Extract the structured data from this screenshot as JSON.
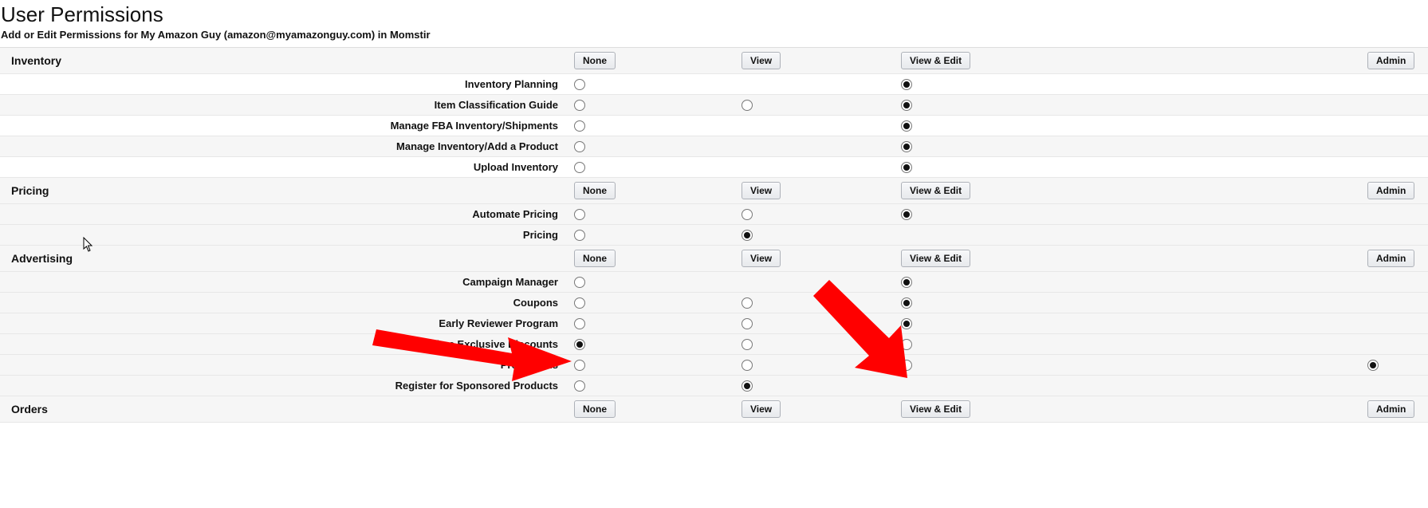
{
  "page_title": "User Permissions",
  "subtitle": "Add or Edit Permissions for My Amazon Guy (amazon@myamazonguy.com) in Momstir",
  "col_buttons": {
    "none": "None",
    "view": "View",
    "view_edit": "View & Edit",
    "admin": "Admin"
  },
  "sections": [
    {
      "name": "Inventory",
      "rows": [
        {
          "label": "Inventory Planning",
          "cells": {
            "none": "empty",
            "view": null,
            "ve": "checked",
            "admin": null
          }
        },
        {
          "label": "Item Classification Guide",
          "cells": {
            "none": "empty",
            "view": "empty",
            "ve": "checked",
            "admin": null
          }
        },
        {
          "label": "Manage FBA Inventory/Shipments",
          "cells": {
            "none": "empty",
            "view": null,
            "ve": "checked",
            "admin": null
          }
        },
        {
          "label": "Manage Inventory/Add a Product",
          "cells": {
            "none": "empty",
            "view": null,
            "ve": "checked",
            "admin": null
          }
        },
        {
          "label": "Upload Inventory",
          "cells": {
            "none": "empty",
            "view": null,
            "ve": "checked",
            "admin": null
          }
        }
      ]
    },
    {
      "name": "Pricing",
      "rows": [
        {
          "label": "Automate Pricing",
          "cells": {
            "none": "empty",
            "view": "empty",
            "ve": "checked",
            "admin": null
          }
        },
        {
          "label": "Pricing",
          "cells": {
            "none": "empty",
            "view": "checked",
            "ve": null,
            "admin": null
          }
        }
      ]
    },
    {
      "name": "Advertising",
      "rows": [
        {
          "label": "Campaign Manager",
          "cells": {
            "none": "empty",
            "view": null,
            "ve": "checked",
            "admin": null
          }
        },
        {
          "label": "Coupons",
          "cells": {
            "none": "empty",
            "view": "empty",
            "ve": "checked",
            "admin": null
          }
        },
        {
          "label": "Early Reviewer Program",
          "cells": {
            "none": "empty",
            "view": "empty",
            "ve": "checked",
            "admin": null
          }
        },
        {
          "label": "Prime Exclusive Discounts",
          "cells": {
            "none": "checked",
            "view": "empty",
            "ve": "empty",
            "admin": null
          }
        },
        {
          "label": "Promotions",
          "cells": {
            "none": "empty",
            "view": "empty",
            "ve": "empty",
            "admin": "checked"
          }
        },
        {
          "label": "Register for Sponsored Products",
          "cells": {
            "none": "empty",
            "view": "checked",
            "ve": null,
            "admin": null
          }
        }
      ]
    },
    {
      "name": "Orders",
      "rows": []
    }
  ]
}
